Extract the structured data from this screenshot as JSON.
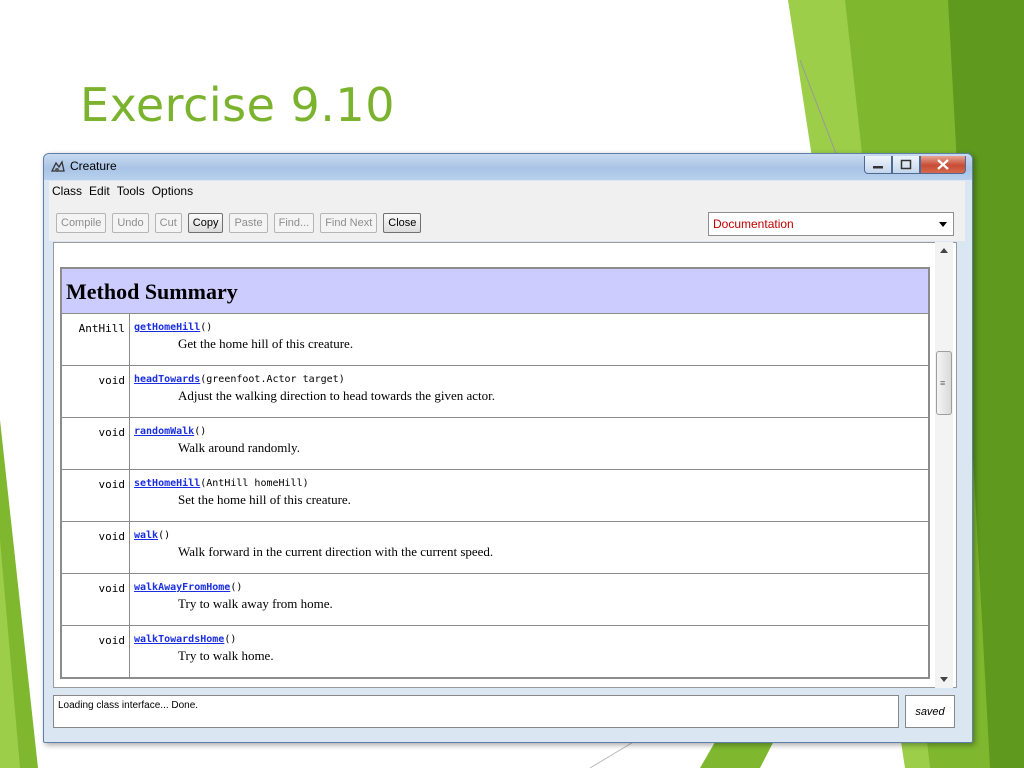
{
  "slide": {
    "title": "Exercise 9.10"
  },
  "window": {
    "title": "Creature",
    "menu": [
      "Class",
      "Edit",
      "Tools",
      "Options"
    ],
    "toolbar": {
      "buttons": [
        {
          "label": "Compile",
          "enabled": false
        },
        {
          "label": "Undo",
          "enabled": false
        },
        {
          "label": "Cut",
          "enabled": false
        },
        {
          "label": "Copy",
          "enabled": true
        },
        {
          "label": "Paste",
          "enabled": false
        },
        {
          "label": "Find...",
          "enabled": false
        },
        {
          "label": "Find Next",
          "enabled": false
        },
        {
          "label": "Close",
          "enabled": true
        }
      ],
      "view_select": "Documentation"
    },
    "doc": {
      "heading": "Method Summary",
      "methods": [
        {
          "returns": "AntHill",
          "name": "getHomeHill",
          "params": "()",
          "description": "Get the home hill of this creature."
        },
        {
          "returns": "void",
          "name": "headTowards",
          "params": "(greenfoot.Actor target)",
          "description": "Adjust the walking direction to head towards the given actor."
        },
        {
          "returns": "void",
          "name": "randomWalk",
          "params": "()",
          "description": "Walk around randomly."
        },
        {
          "returns": "void",
          "name": "setHomeHill",
          "params": "(AntHill homeHill)",
          "description": "Set the home hill of this creature."
        },
        {
          "returns": "void",
          "name": "walk",
          "params": "()",
          "description": "Walk forward in the current direction with the current speed."
        },
        {
          "returns": "void",
          "name": "walkAwayFromHome",
          "params": "()",
          "description": "Try to walk away from home."
        },
        {
          "returns": "void",
          "name": "walkTowardsHome",
          "params": "()",
          "description": "Try to walk home."
        }
      ]
    },
    "status": {
      "message": "Loading class interface... Done.",
      "saved": "saved"
    }
  },
  "colors": {
    "title_green": "#7bb32e",
    "summary_header": "#ccccff",
    "link": "#1a2ee0"
  }
}
